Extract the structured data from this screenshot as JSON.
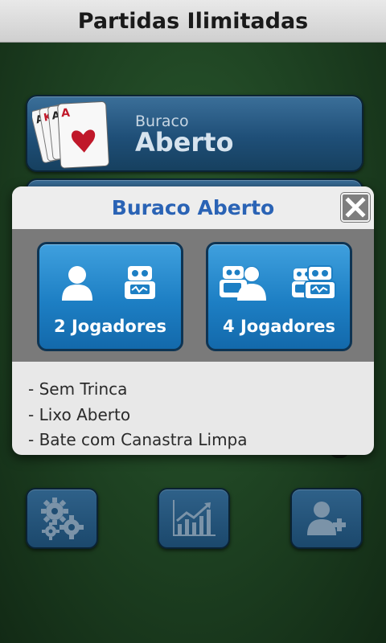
{
  "header": {
    "title": "Partidas Ilimitadas"
  },
  "games": [
    {
      "subtitle": "Buraco",
      "title": "Aberto"
    }
  ],
  "dialog": {
    "title": "Buraco Aberto",
    "close_icon": "close-icon",
    "options": [
      {
        "label": "2 Jogadores",
        "icons": [
          "person-icon",
          "robot-icon"
        ]
      },
      {
        "label": "4 Jogadores",
        "icons": [
          "robot-person-group-icon",
          "robot-group-icon"
        ]
      }
    ],
    "rules": [
      "- Sem Trinca",
      "- Lixo Aberto",
      "- Bate com Canastra Limpa"
    ]
  },
  "toolbar": {
    "buttons": [
      {
        "icon": "gears-icon"
      },
      {
        "icon": "chart-icon"
      },
      {
        "icon": "add-user-icon"
      }
    ]
  },
  "colors": {
    "accent": "#2a63b5",
    "button_blue": "#1d7fc4",
    "felt_green": "#1f4423"
  }
}
